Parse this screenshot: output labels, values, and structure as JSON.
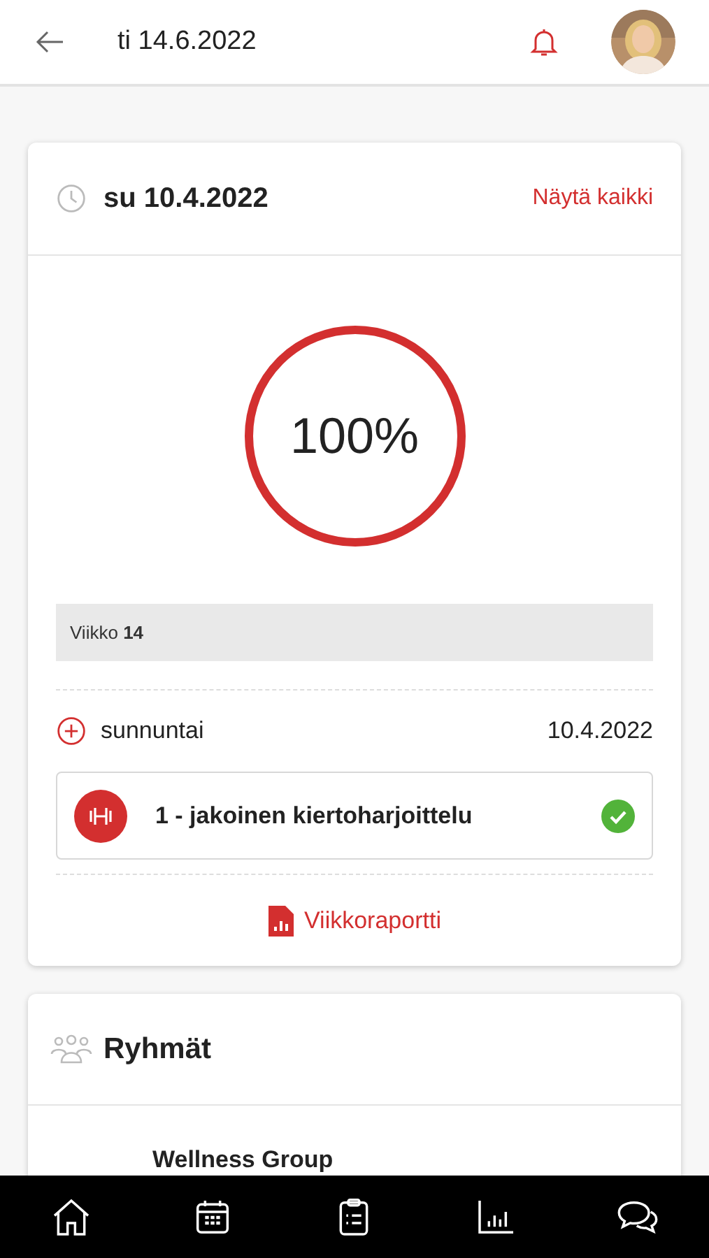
{
  "header": {
    "date": "ti 14.6.2022"
  },
  "summary": {
    "date": "su 10.4.2022",
    "link": "Näytä kaikki",
    "progress": {
      "level": 1,
      "reading": "100%"
    },
    "week": "Viikko **14**",
    "day": {
      "name": "sunnuntai",
      "date": "10.4.2022"
    },
    "workouts": [
      {
        "title": "1 - jakoinen kiertoharjoittelu",
        "completed": true
      }
    ],
    "report": "Viikkoraportti"
  },
  "groups": {
    "title": "Ryhmät",
    "items": [
      "Wellness Group"
    ]
  },
  "nav": [
    {
      "kind": "home"
    },
    {
      "kind": "calendar"
    },
    {
      "kind": "tasks"
    },
    {
      "kind": "stats"
    },
    {
      "kind": "chat"
    }
  ]
}
